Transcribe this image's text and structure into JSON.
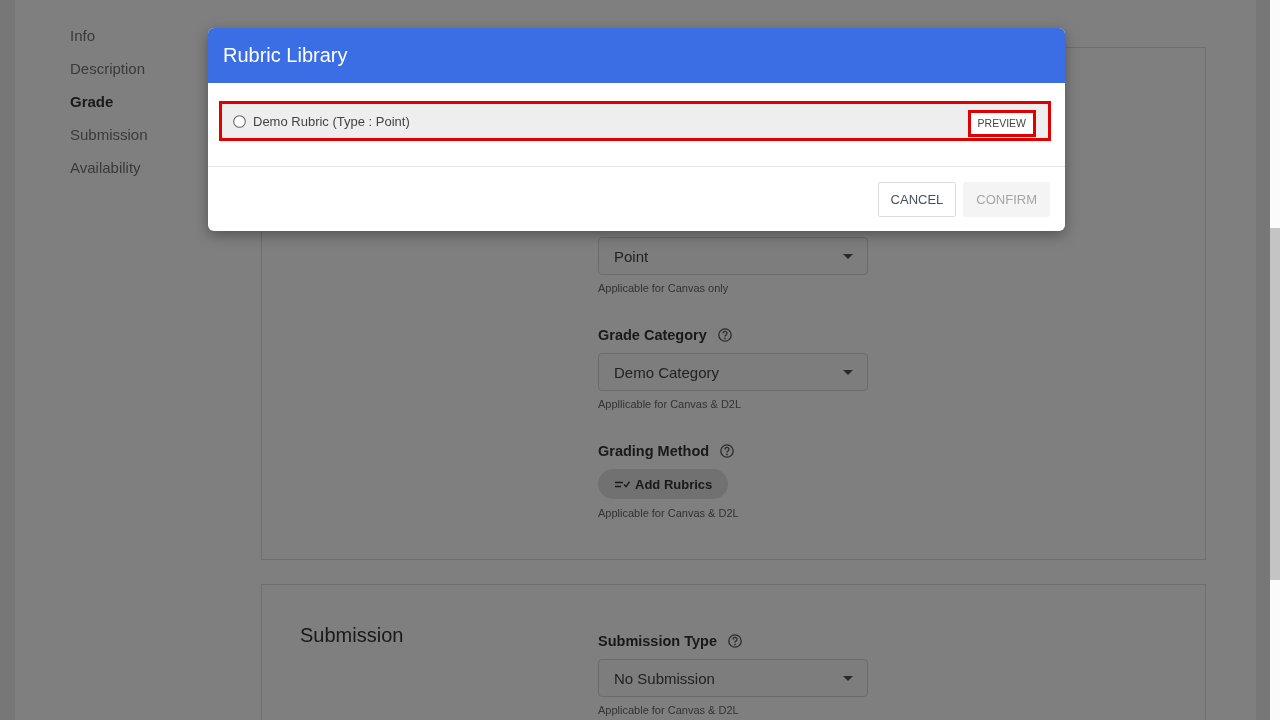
{
  "sidebar": {
    "items": [
      {
        "label": "Info",
        "selected": false
      },
      {
        "label": "Description",
        "selected": false
      },
      {
        "label": "Grade",
        "selected": true
      },
      {
        "label": "Submission",
        "selected": false
      },
      {
        "label": "Availability",
        "selected": false
      }
    ]
  },
  "grade_section": {
    "fields": [
      {
        "kind": "select",
        "value": "Point",
        "helper": "Applicable for Canvas only"
      },
      {
        "kind": "select",
        "label": "Grade Category",
        "value": "Demo Category",
        "helper": "Appllicable for Canvas & D2L"
      },
      {
        "kind": "button",
        "label": "Grading Method",
        "button": "Add Rubrics",
        "helper": "Applicable for Canvas & D2L"
      }
    ]
  },
  "submission_section": {
    "title": "Submission",
    "fields": [
      {
        "kind": "select",
        "label": "Submission Type",
        "value": "No Submission",
        "helper": "Applicable for Canvas & D2L"
      }
    ]
  },
  "dialog": {
    "title": "Rubric Library",
    "rubrics": [
      {
        "label": "Demo Rubric (Type : Point)",
        "selected": false,
        "highlighted": true,
        "preview": {
          "label": "PREVIEW",
          "highlighted": true
        }
      }
    ],
    "buttons": [
      {
        "label": "CANCEL",
        "disabled": false
      },
      {
        "label": "CONFIRM",
        "disabled": true
      }
    ]
  }
}
